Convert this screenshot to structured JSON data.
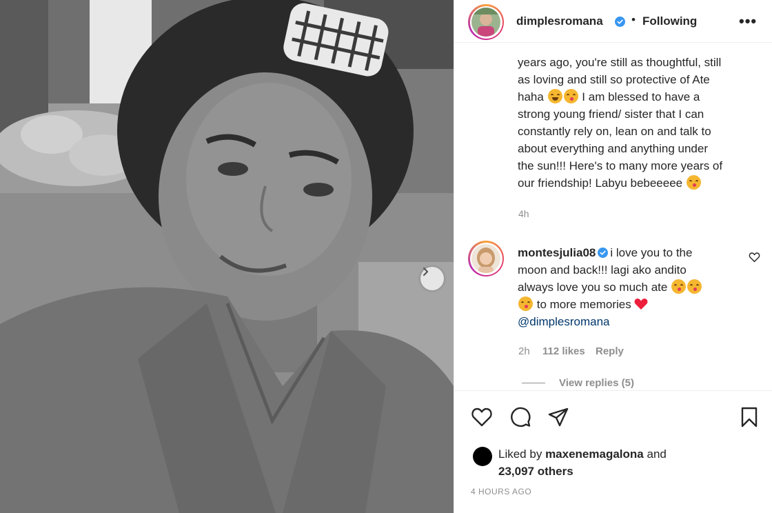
{
  "post": {
    "username": "dimplesromana",
    "follow_separator": "•",
    "follow_status": "Following",
    "more_label": "•••"
  },
  "caption": {
    "lines": [
      "years ago, you're still as thoughtful, still",
      "as loving and still so protective of Ate",
      "I am blessed to have a",
      "strong young friend/ sister that I can",
      "constantly rely on, lean on and talk to",
      "about everything and anything under",
      "the sun!!! Here's to many more years of",
      "our friendship! Labyu bebeeeee"
    ],
    "line3_prefix": "haha",
    "emojis": [
      "grinning-squinting-face",
      "face-blowing-kiss"
    ],
    "time": "4h"
  },
  "comment": {
    "username": "montesjulia08",
    "line1": "i love you to the",
    "line2": "moon and back!!! lagi ako andito",
    "line3": "always love you so much ate",
    "line4": "to more memories",
    "mention": "@dimplesromana",
    "time": "2h",
    "likes": "112 likes",
    "reply": "Reply",
    "view_replies": "View replies (5)"
  },
  "likes": {
    "prefix": "Liked by",
    "user": "maxenemagalona",
    "and": "and",
    "others": "23,097 others"
  },
  "posted_ago": "4 HOURS AGO",
  "icons": {
    "verified": "verified-badge-icon",
    "like": "heart-outline-icon",
    "comment": "comment-bubble-icon",
    "share": "paper-plane-icon",
    "save": "bookmark-icon",
    "next": "chevron-right-icon"
  },
  "colors": {
    "verified_blue": "#3897f0",
    "heart_red": "#ed1e3c",
    "mention_blue": "#00376b",
    "muted": "#8e8e8e"
  }
}
